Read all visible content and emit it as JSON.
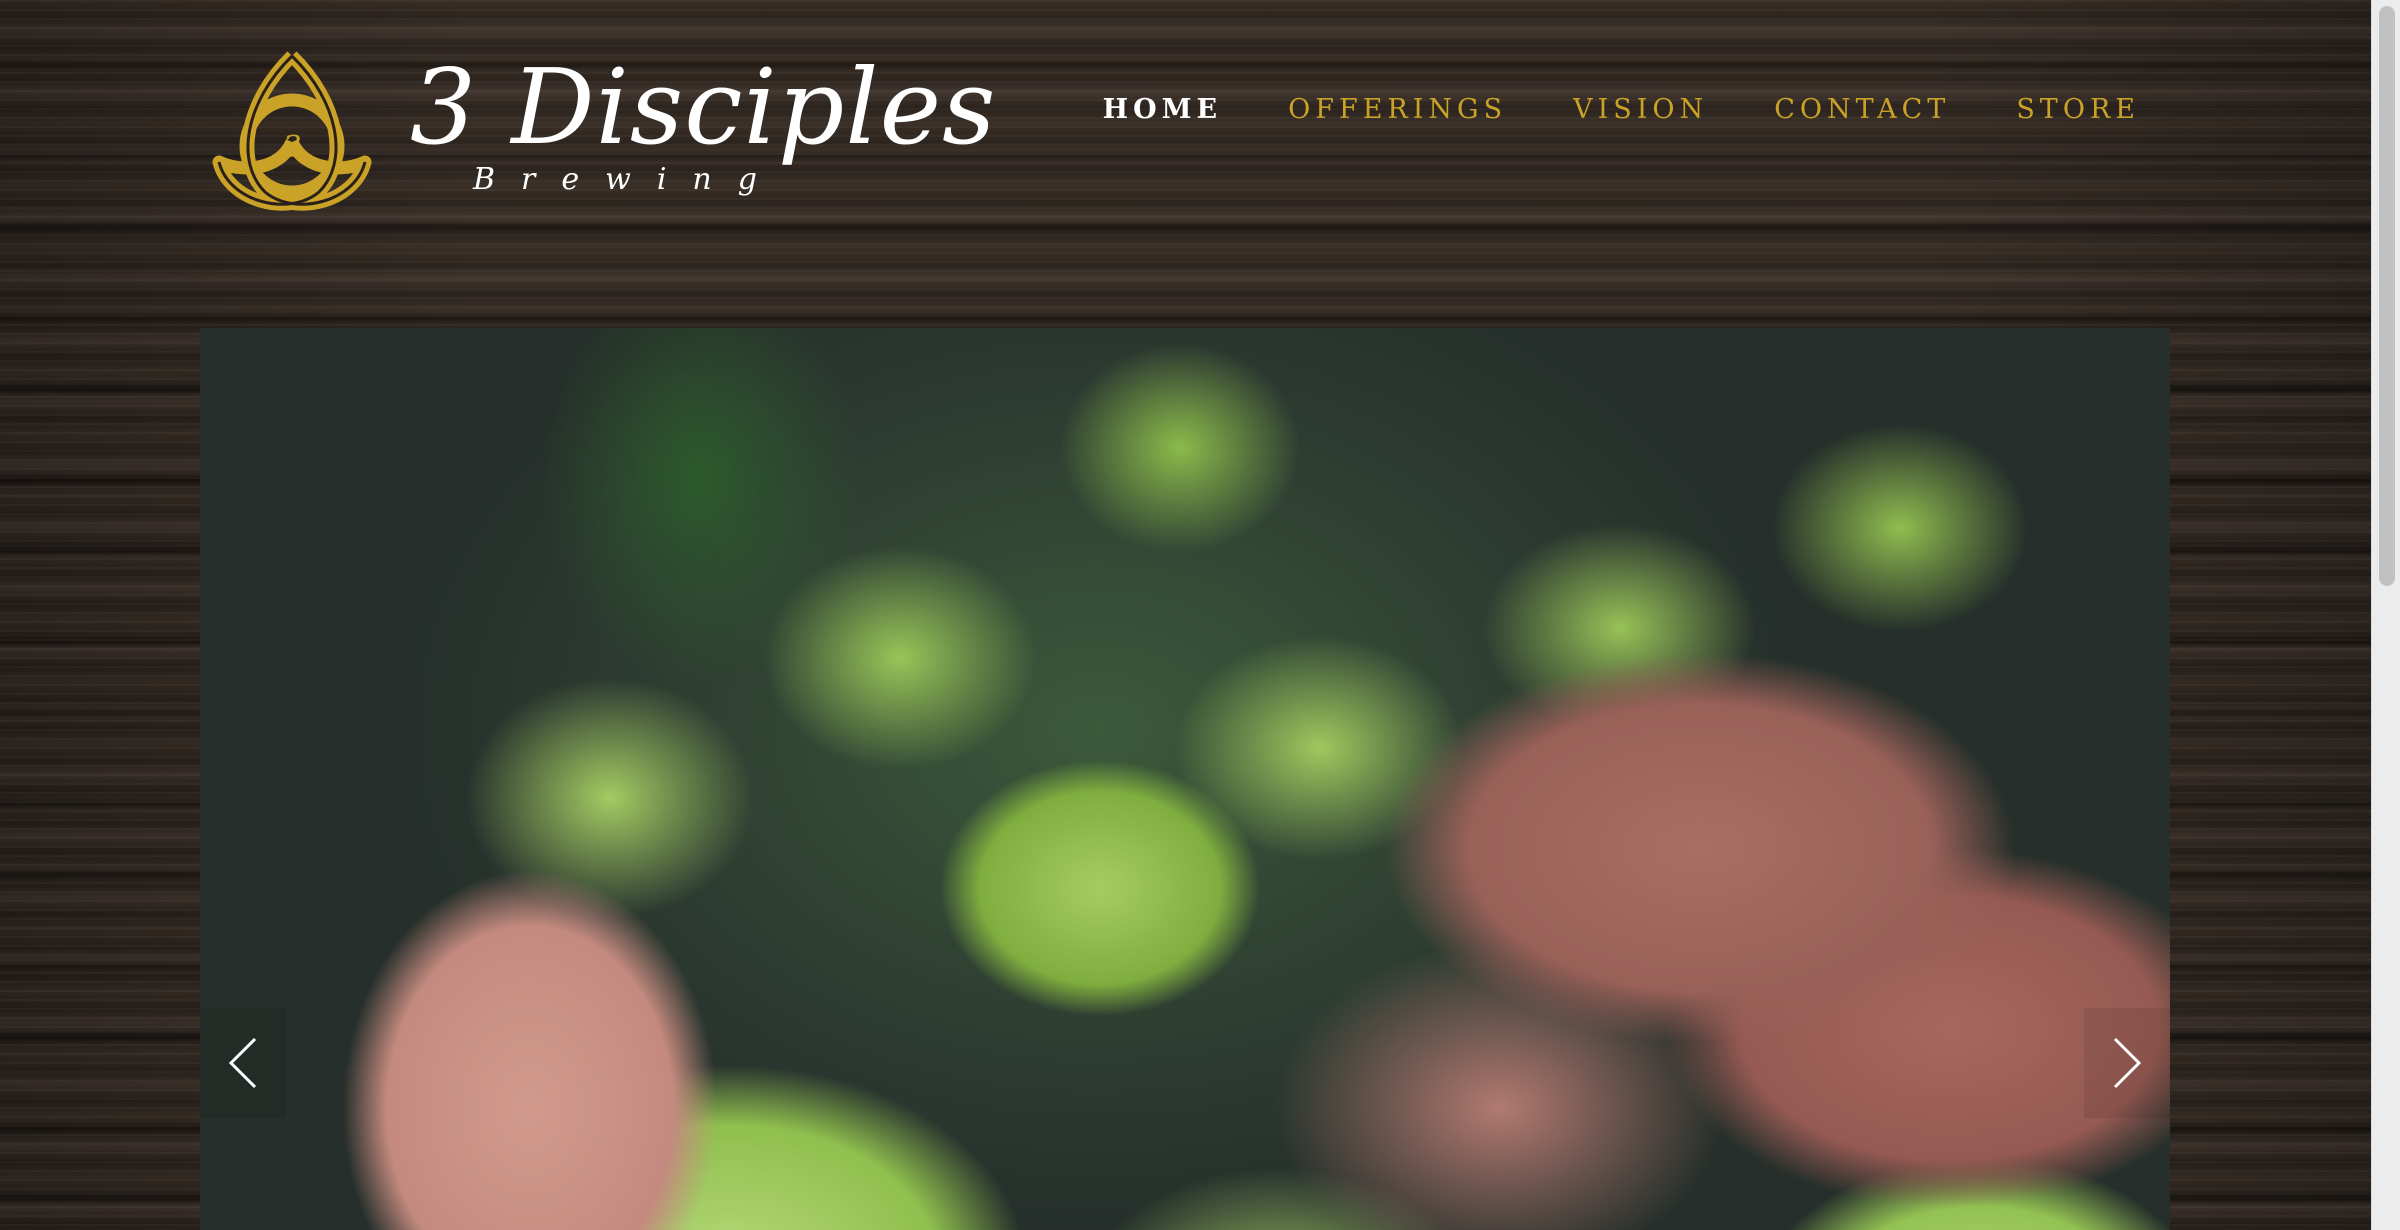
{
  "brand": {
    "name": "3 Disciples",
    "sub": "Brewing",
    "knot_numeral": "3",
    "logo_gold": "#c9a227"
  },
  "nav": {
    "items": [
      {
        "label": "HOME",
        "active": true
      },
      {
        "label": "OFFERINGS",
        "active": false
      },
      {
        "label": "VISION",
        "active": false
      },
      {
        "label": "CONTACT",
        "active": false
      },
      {
        "label": "STORE",
        "active": false
      }
    ],
    "active_color": "#ffffff",
    "color": "#c9a227"
  },
  "slider": {
    "image": "hops-in-hand-photo",
    "prev_icon": "chevron-left-icon",
    "next_icon": "chevron-right-icon"
  }
}
